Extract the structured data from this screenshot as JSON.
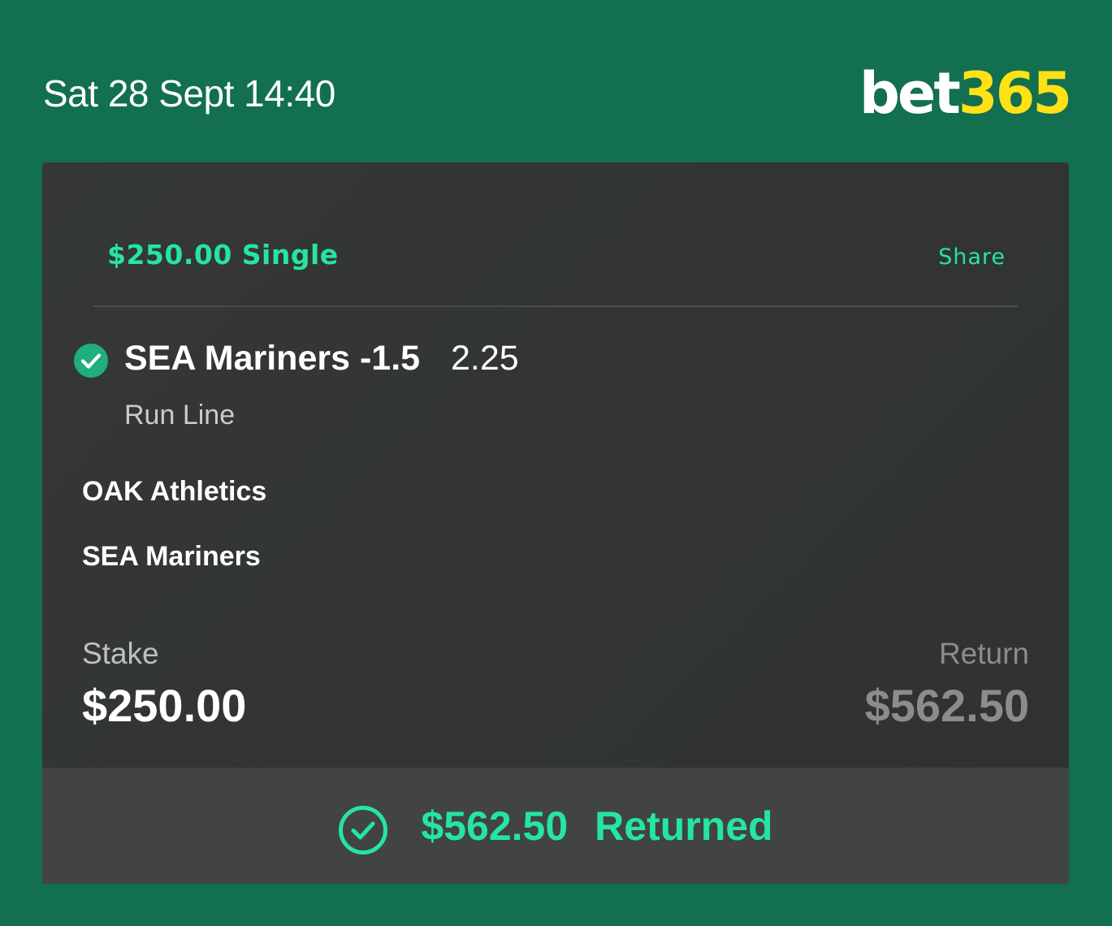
{
  "header": {
    "datetime": "Sat 28 Sept 14:40",
    "logo_bet": "bet",
    "logo_num": "365"
  },
  "bet": {
    "title": "$250.00 Single",
    "share_label": "Share",
    "selection": "SEA Mariners -1.5",
    "odds": "2.25",
    "market": "Run Line",
    "teams": [
      "OAK Athletics",
      "SEA Mariners"
    ],
    "stake_label": "Stake",
    "stake_value": "$250.00",
    "return_label": "Return",
    "return_value": "$562.50"
  },
  "footer": {
    "amount": "$562.50",
    "status": "Returned"
  },
  "icons": {
    "selection_status": "check-circle-filled-icon",
    "footer_status": "check-circle-outline-icon"
  },
  "colors": {
    "background": "#126f50",
    "accent_green": "#25e5a0",
    "logo_yellow": "#ffe115",
    "card": "#333634",
    "footer": "#414442"
  }
}
